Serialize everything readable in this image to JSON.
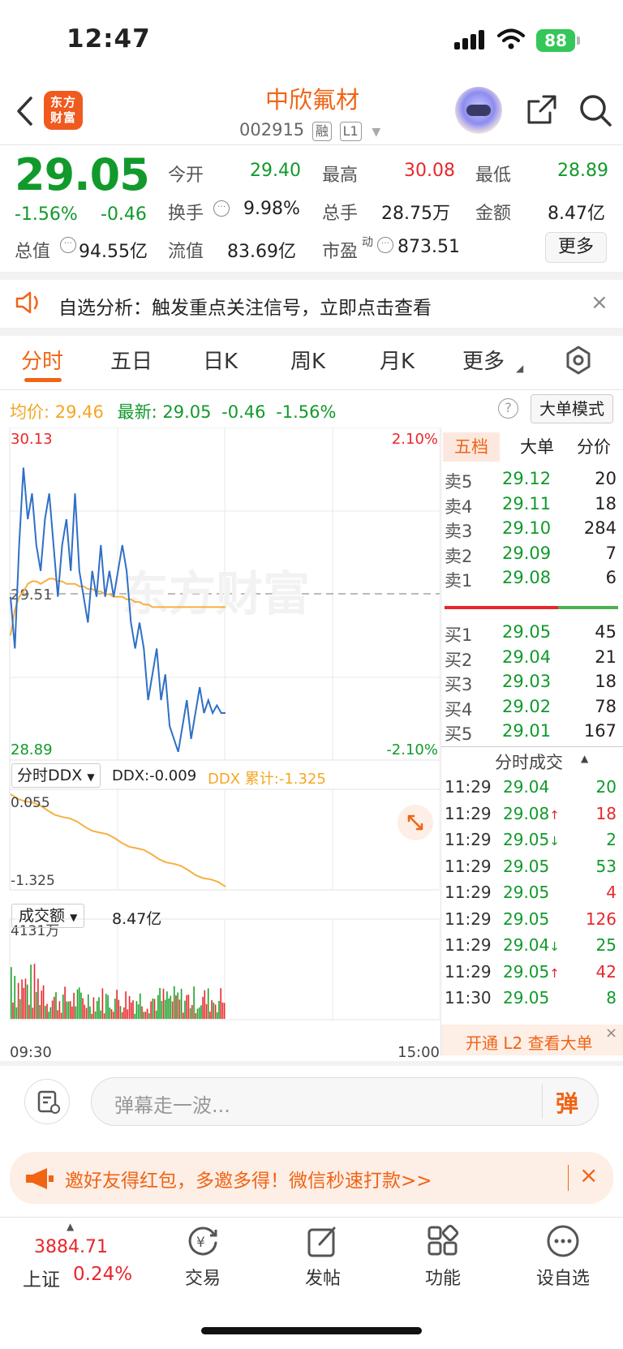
{
  "status_bar": {
    "time": "12:47",
    "battery": "88"
  },
  "header": {
    "logo_text": "东方财富",
    "stock_name": "中欣氟材",
    "stock_code": "002915",
    "tag_margin": "融",
    "tag_level": "L1"
  },
  "quote": {
    "price": "29.05",
    "change_pct": "-1.56%",
    "change": "-0.46",
    "open_label": "今开",
    "open": "29.40",
    "high_label": "最高",
    "high": "30.08",
    "low_label": "最低",
    "low": "28.89",
    "turnover_label": "换手",
    "turnover": "9.98%",
    "volume_label": "总手",
    "volume": "28.75万",
    "amount_label": "金额",
    "amount": "8.47亿",
    "total_cap_label": "总值",
    "total_cap": "94.55亿",
    "float_cap_label": "流值",
    "float_cap": "83.69亿",
    "pe_label": "市盈",
    "pe_sup": "动",
    "pe": "873.51",
    "more": "更多"
  },
  "notice": {
    "text": "自选分析：触发重点关注信号，立即点击查看"
  },
  "tabs": [
    "分时",
    "五日",
    "日K",
    "周K",
    "月K",
    "更多"
  ],
  "chart_info": {
    "avg_label": "均价:",
    "avg": "29.46",
    "latest_label": "最新:",
    "latest": "29.05",
    "latest_change": "-0.46",
    "latest_pct": "-1.56%",
    "mode_button": "大单模式"
  },
  "chart_data": {
    "type": "line",
    "title": "",
    "x_start_label": "09:30",
    "x_end_label": "15:00",
    "y_max_label": "30.13",
    "y_mid_label": "29.51",
    "y_min_label": "28.89",
    "pct_max_label": "2.10%",
    "pct_min_label": "-2.10%",
    "ylim": [
      28.89,
      30.13
    ],
    "series": [
      {
        "values": [
          29.5,
          29.3,
          29.7,
          30.0,
          29.8,
          29.9,
          29.7,
          29.6,
          29.8,
          29.9,
          29.7,
          29.5,
          29.7,
          29.8,
          29.6,
          29.9,
          29.6,
          29.5,
          29.4,
          29.6,
          29.5,
          29.7,
          29.5,
          29.6,
          29.5,
          29.6,
          29.7,
          29.6,
          29.4,
          29.3,
          29.4,
          29.3,
          29.1,
          29.2,
          29.3,
          29.1,
          29.2,
          29.0,
          28.95,
          28.9,
          29.0,
          29.1,
          28.95,
          29.05,
          29.15,
          29.05,
          29.1,
          29.05,
          29.08,
          29.05,
          29.05
        ]
      },
      {
        "values": [
          29.35,
          29.45,
          29.5,
          29.52,
          29.55,
          29.56,
          29.56,
          29.55,
          29.56,
          29.57,
          29.57,
          29.56,
          29.56,
          29.55,
          29.55,
          29.55,
          29.54,
          29.54,
          29.53,
          29.53,
          29.52,
          29.52,
          29.51,
          29.51,
          29.5,
          29.5,
          29.5,
          29.49,
          29.49,
          29.48,
          29.48,
          29.47,
          29.47,
          29.46,
          29.46,
          29.46,
          29.46,
          29.46,
          29.46,
          29.46,
          29.46,
          29.46,
          29.46,
          29.46,
          29.46,
          29.46,
          29.46,
          29.46,
          29.46,
          29.46,
          29.46
        ]
      }
    ],
    "ddx_panel": {
      "selector": "分时DDX",
      "ddx": "DDX:-0.009",
      "ddx_cum": "DDX 累计:-1.325",
      "top": "0.055",
      "bottom": "-1.325"
    },
    "volume_panel": {
      "selector": "成交额",
      "total": "8.47亿",
      "max_label": "4131万"
    }
  },
  "order_book": {
    "tabs": [
      "五档",
      "大单",
      "分价"
    ],
    "asks": [
      {
        "label": "卖5",
        "price": "29.12",
        "vol": "20"
      },
      {
        "label": "卖4",
        "price": "29.11",
        "vol": "18"
      },
      {
        "label": "卖3",
        "price": "29.10",
        "vol": "284"
      },
      {
        "label": "卖2",
        "price": "29.09",
        "vol": "7"
      },
      {
        "label": "卖1",
        "price": "29.08",
        "vol": "6"
      }
    ],
    "bids": [
      {
        "label": "买1",
        "price": "29.05",
        "vol": "45"
      },
      {
        "label": "买2",
        "price": "29.04",
        "vol": "21"
      },
      {
        "label": "买3",
        "price": "29.03",
        "vol": "18"
      },
      {
        "label": "买4",
        "price": "29.02",
        "vol": "78"
      },
      {
        "label": "买5",
        "price": "29.01",
        "vol": "167"
      }
    ]
  },
  "trades": {
    "title": "分时成交",
    "rows": [
      {
        "time": "11:29",
        "price": "29.04",
        "vol": "20",
        "color": "#119a2b"
      },
      {
        "time": "11:29",
        "price": "29.08↑",
        "vol": "18",
        "color": "#e8272b"
      },
      {
        "time": "11:29",
        "price": "29.05↓",
        "vol": "2",
        "color": "#119a2b"
      },
      {
        "time": "11:29",
        "price": "29.05",
        "vol": "53",
        "color": "#119a2b"
      },
      {
        "time": "11:29",
        "price": "29.05",
        "vol": "4",
        "color": "#e8272b"
      },
      {
        "time": "11:29",
        "price": "29.05",
        "vol": "126",
        "color": "#e8272b"
      },
      {
        "time": "11:29",
        "price": "29.04↓",
        "vol": "25",
        "color": "#119a2b"
      },
      {
        "time": "11:29",
        "price": "29.05↑",
        "vol": "42",
        "color": "#e8272b"
      },
      {
        "time": "11:30",
        "price": "29.05",
        "vol": "8",
        "color": "#119a2b"
      }
    ],
    "l2_banner": "开通 L2 查看大单"
  },
  "comment": {
    "placeholder": "弹幕走一波...",
    "send": "弹"
  },
  "promo": {
    "text": "邀好友得红包，多邀多得！微信秒速打款>>"
  },
  "bottom_nav": {
    "index_value": "3884.71",
    "index_name": "上证",
    "index_pct": "0.24%",
    "items": [
      "交易",
      "发帖",
      "功能",
      "设自选"
    ]
  }
}
